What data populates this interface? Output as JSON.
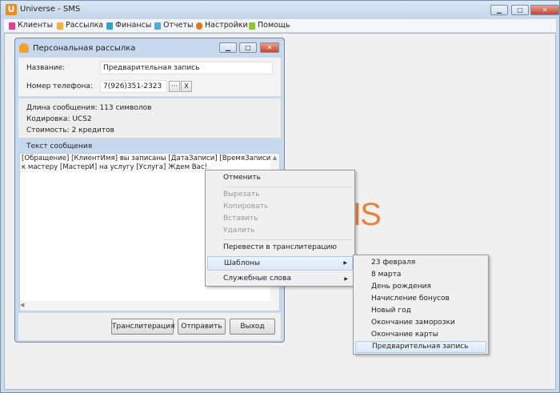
{
  "app": {
    "title": "Universe - SMS",
    "logo_letter": "U",
    "background_logo": "IS"
  },
  "window_controls": {
    "minimize": "▁",
    "maximize": "□",
    "close": "✕"
  },
  "menubar": [
    {
      "label": "Клиенты",
      "icon": "clients-icon",
      "color": "#e0408a"
    },
    {
      "label": "Рассылка",
      "icon": "mailing-icon",
      "color": "#f2b24a"
    },
    {
      "label": "Финансы",
      "icon": "finance-icon",
      "color": "#3aa0c8"
    },
    {
      "label": "Отчеты",
      "icon": "reports-icon",
      "color": "#58a8e0"
    },
    {
      "label": "Настройки",
      "icon": "settings-icon",
      "color": "#e07a20"
    },
    {
      "label": "Помощь",
      "icon": "help-icon",
      "color": "#8cc43c"
    }
  ],
  "dialog": {
    "title": "Персональная рассылка",
    "name_label": "Название:",
    "name_value": "Предварительная запись",
    "phone_label": "Номер телефона:",
    "phone_value": "7(926)351-2323",
    "browse_btn": "···",
    "clear_btn": "X",
    "length": "Длина сообщения: 113 символов",
    "encoding": "Кодировка: UCS2",
    "cost": "Стоимость: 2 кредитов",
    "text_label": "Текст сообщения",
    "text_line1": "[Обращение] [КлиентИмя] вы записаны [ДатаЗаписи] [ВремяЗаписи]",
    "text_line2": "к мастеру [МастерИ] на услугу [Услуга] Ждем Вас!",
    "btn_translit": "Транслитерация",
    "btn_send": "Отправить",
    "btn_exit": "Выход"
  },
  "context_menu": {
    "undo": "Отменить",
    "cut": "Вырезать",
    "copy": "Копировать",
    "paste": "Вставить",
    "delete": "Удалить",
    "translit": "Перевести в транслитерацию",
    "templates": "Шаблоны",
    "service_words": "Служебные слова",
    "arrow": "▶"
  },
  "templates": [
    "23 февраля",
    "8 марта",
    "День рождения",
    "Начисление бонусов",
    "Новый год",
    "Окончание заморозки",
    "Окончание карты",
    "Предварительная запись"
  ]
}
